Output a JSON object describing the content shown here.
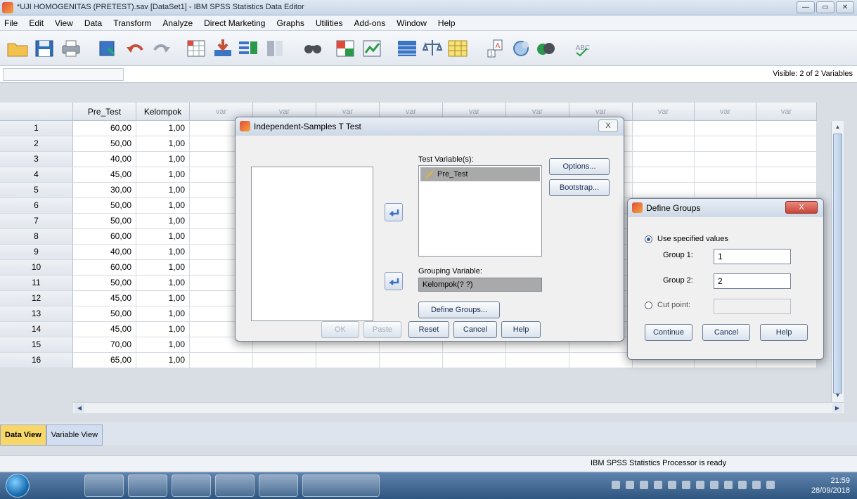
{
  "window": {
    "title": "*UJI HOMOGENITAS (PRETEST).sav [DataSet1] - IBM SPSS Statistics Data Editor"
  },
  "menu": [
    "File",
    "Edit",
    "View",
    "Data",
    "Transform",
    "Analyze",
    "Direct Marketing",
    "Graphs",
    "Utilities",
    "Add-ons",
    "Window",
    "Help"
  ],
  "cellinfo": {
    "visible": "Visible: 2 of 2 Variables"
  },
  "grid": {
    "headers": [
      "",
      "Pre_Test",
      "Kelompok",
      "var",
      "var",
      "var",
      "var",
      "var",
      "var",
      "var",
      "var",
      "var",
      "var"
    ],
    "rows": [
      [
        "1",
        "60,00",
        "1,00"
      ],
      [
        "2",
        "50,00",
        "1,00"
      ],
      [
        "3",
        "40,00",
        "1,00"
      ],
      [
        "4",
        "45,00",
        "1,00"
      ],
      [
        "5",
        "30,00",
        "1,00"
      ],
      [
        "6",
        "50,00",
        "1,00"
      ],
      [
        "7",
        "50,00",
        "1,00"
      ],
      [
        "8",
        "60,00",
        "1,00"
      ],
      [
        "9",
        "40,00",
        "1,00"
      ],
      [
        "10",
        "60,00",
        "1,00"
      ],
      [
        "11",
        "50,00",
        "1,00"
      ],
      [
        "12",
        "45,00",
        "1,00"
      ],
      [
        "13",
        "50,00",
        "1,00"
      ],
      [
        "14",
        "45,00",
        "1,00"
      ],
      [
        "15",
        "70,00",
        "1,00"
      ],
      [
        "16",
        "65,00",
        "1,00"
      ]
    ]
  },
  "tabs": {
    "data_view": "Data View",
    "variable_view": "Variable View"
  },
  "status": {
    "text": "IBM SPSS Statistics Processor is ready"
  },
  "clock": {
    "time": "21:59",
    "date": "28/09/2018"
  },
  "ttest_dialog": {
    "title": "Independent-Samples T Test",
    "close": "X",
    "test_var_label": "Test Variable(s):",
    "test_var_item": "Pre_Test",
    "grouping_label": "Grouping Variable:",
    "grouping_value": "Kelompok(? ?)",
    "define_groups": "Define Groups...",
    "options": "Options...",
    "bootstrap": "Bootstrap...",
    "ok": "OK",
    "paste": "Paste",
    "reset": "Reset",
    "cancel": "Cancel",
    "help": "Help"
  },
  "define_dialog": {
    "title": "Define Groups",
    "close": "X",
    "use_specified": "Use specified values",
    "group1_label": "Group 1:",
    "group1_value": "1",
    "group2_label": "Group 2:",
    "group2_value": "2",
    "cut_point": "Cut point:",
    "continue": "Continue",
    "cancel": "Cancel",
    "help": "Help"
  },
  "colors": {
    "active_tab": "#f7d66a",
    "selected_item": "#a9a9a9",
    "close_red": "#c8463a"
  }
}
